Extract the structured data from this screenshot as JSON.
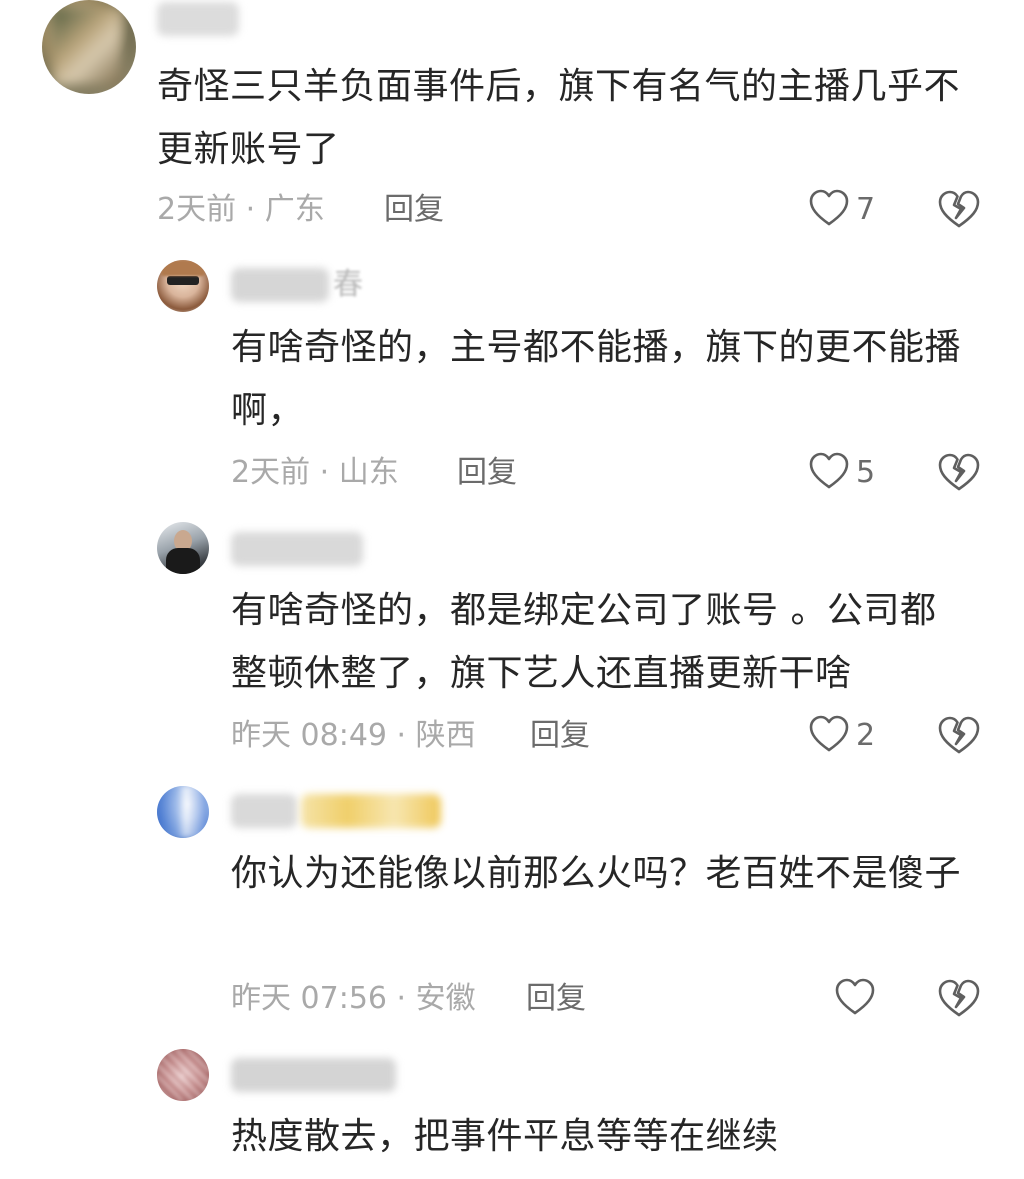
{
  "comments": [
    {
      "username_visible_suffix": "",
      "text": "奇怪三只羊负面事件后，旗下有名气的主播几乎不更新账号了",
      "time": "2天前",
      "location": "广东",
      "meta": "2天前 · 广东",
      "reply_label": "回复",
      "likes": "7"
    },
    {
      "username_visible_suffix": "春",
      "text": "有啥奇怪的，主号都不能播，旗下的更不能播啊，",
      "time": "2天前",
      "location": "山东",
      "meta": "2天前 · 山东",
      "reply_label": "回复",
      "likes": "5"
    },
    {
      "username_visible_suffix": "",
      "text": "有啥奇怪的，都是绑定公司了账号 。公司都整顿休整了，旗下艺人还直播更新干啥",
      "time": "昨天 08:49",
      "location": "陕西",
      "meta": "昨天 08:49 · 陕西",
      "reply_label": "回复",
      "likes": "2"
    },
    {
      "username_visible_suffix": "",
      "text": "你认为还能像以前那么火吗？老百姓不是傻子",
      "time": "昨天 07:56",
      "location": "安徽",
      "meta": "昨天 07:56 · 安徽",
      "reply_label": "回复",
      "likes": ""
    },
    {
      "username_visible_suffix": "",
      "text": "热度散去，把事件平息等等在继续",
      "time": "",
      "location": "",
      "meta": "",
      "reply_label": "",
      "likes": ""
    }
  ],
  "icons": {
    "like": "heart-outline-icon",
    "dislike": "broken-heart-icon"
  },
  "colors": {
    "text": "#262626",
    "meta": "#a9a9a9",
    "action": "#6b6b6b"
  }
}
